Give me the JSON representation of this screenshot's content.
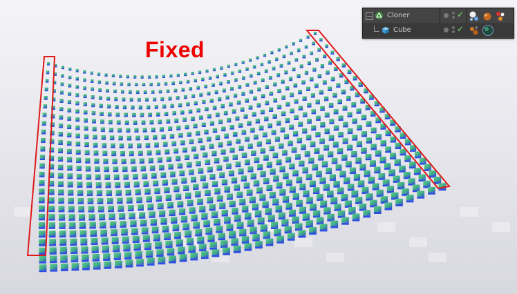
{
  "annotation": {
    "label": "Fixed",
    "color": "#ee0000"
  },
  "object_manager": {
    "rows": [
      {
        "name": "Cloner",
        "icon": "cloner-icon",
        "enabled": "✓"
      },
      {
        "name": "Cube",
        "icon": "cube-icon",
        "enabled": "✓"
      }
    ]
  },
  "colors": {
    "background": "#e9e9ee",
    "panel": "#3d3d3d",
    "clone_top": "#57c28c",
    "clone_side": "#2f4fe0",
    "highlight": "#e01818"
  }
}
